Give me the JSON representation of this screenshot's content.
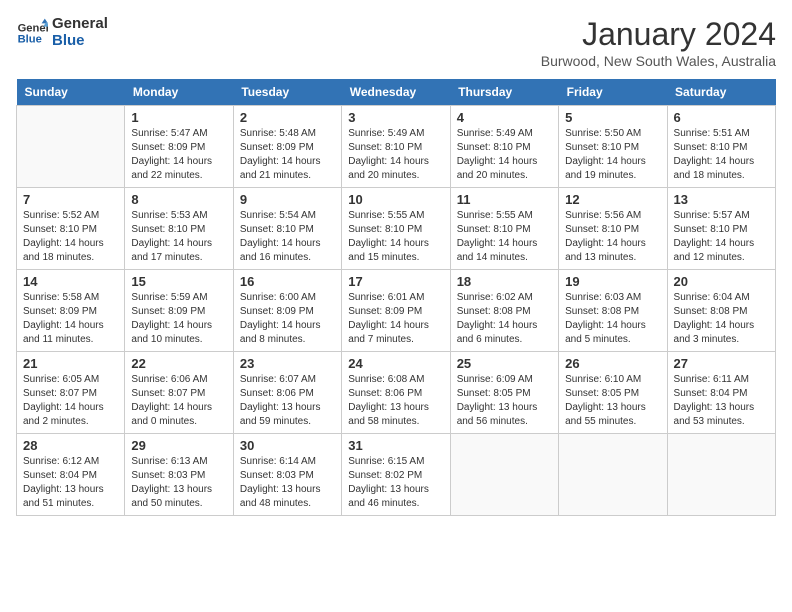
{
  "logo": {
    "line1": "General",
    "line2": "Blue"
  },
  "title": "January 2024",
  "subtitle": "Burwood, New South Wales, Australia",
  "days_of_week": [
    "Sunday",
    "Monday",
    "Tuesday",
    "Wednesday",
    "Thursday",
    "Friday",
    "Saturday"
  ],
  "weeks": [
    [
      {
        "day": "",
        "info": ""
      },
      {
        "day": "1",
        "info": "Sunrise: 5:47 AM\nSunset: 8:09 PM\nDaylight: 14 hours\nand 22 minutes."
      },
      {
        "day": "2",
        "info": "Sunrise: 5:48 AM\nSunset: 8:09 PM\nDaylight: 14 hours\nand 21 minutes."
      },
      {
        "day": "3",
        "info": "Sunrise: 5:49 AM\nSunset: 8:10 PM\nDaylight: 14 hours\nand 20 minutes."
      },
      {
        "day": "4",
        "info": "Sunrise: 5:49 AM\nSunset: 8:10 PM\nDaylight: 14 hours\nand 20 minutes."
      },
      {
        "day": "5",
        "info": "Sunrise: 5:50 AM\nSunset: 8:10 PM\nDaylight: 14 hours\nand 19 minutes."
      },
      {
        "day": "6",
        "info": "Sunrise: 5:51 AM\nSunset: 8:10 PM\nDaylight: 14 hours\nand 18 minutes."
      }
    ],
    [
      {
        "day": "7",
        "info": "Sunrise: 5:52 AM\nSunset: 8:10 PM\nDaylight: 14 hours\nand 18 minutes."
      },
      {
        "day": "8",
        "info": "Sunrise: 5:53 AM\nSunset: 8:10 PM\nDaylight: 14 hours\nand 17 minutes."
      },
      {
        "day": "9",
        "info": "Sunrise: 5:54 AM\nSunset: 8:10 PM\nDaylight: 14 hours\nand 16 minutes."
      },
      {
        "day": "10",
        "info": "Sunrise: 5:55 AM\nSunset: 8:10 PM\nDaylight: 14 hours\nand 15 minutes."
      },
      {
        "day": "11",
        "info": "Sunrise: 5:55 AM\nSunset: 8:10 PM\nDaylight: 14 hours\nand 14 minutes."
      },
      {
        "day": "12",
        "info": "Sunrise: 5:56 AM\nSunset: 8:10 PM\nDaylight: 14 hours\nand 13 minutes."
      },
      {
        "day": "13",
        "info": "Sunrise: 5:57 AM\nSunset: 8:10 PM\nDaylight: 14 hours\nand 12 minutes."
      }
    ],
    [
      {
        "day": "14",
        "info": "Sunrise: 5:58 AM\nSunset: 8:09 PM\nDaylight: 14 hours\nand 11 minutes."
      },
      {
        "day": "15",
        "info": "Sunrise: 5:59 AM\nSunset: 8:09 PM\nDaylight: 14 hours\nand 10 minutes."
      },
      {
        "day": "16",
        "info": "Sunrise: 6:00 AM\nSunset: 8:09 PM\nDaylight: 14 hours\nand 8 minutes."
      },
      {
        "day": "17",
        "info": "Sunrise: 6:01 AM\nSunset: 8:09 PM\nDaylight: 14 hours\nand 7 minutes."
      },
      {
        "day": "18",
        "info": "Sunrise: 6:02 AM\nSunset: 8:08 PM\nDaylight: 14 hours\nand 6 minutes."
      },
      {
        "day": "19",
        "info": "Sunrise: 6:03 AM\nSunset: 8:08 PM\nDaylight: 14 hours\nand 5 minutes."
      },
      {
        "day": "20",
        "info": "Sunrise: 6:04 AM\nSunset: 8:08 PM\nDaylight: 14 hours\nand 3 minutes."
      }
    ],
    [
      {
        "day": "21",
        "info": "Sunrise: 6:05 AM\nSunset: 8:07 PM\nDaylight: 14 hours\nand 2 minutes."
      },
      {
        "day": "22",
        "info": "Sunrise: 6:06 AM\nSunset: 8:07 PM\nDaylight: 14 hours\nand 0 minutes."
      },
      {
        "day": "23",
        "info": "Sunrise: 6:07 AM\nSunset: 8:06 PM\nDaylight: 13 hours\nand 59 minutes."
      },
      {
        "day": "24",
        "info": "Sunrise: 6:08 AM\nSunset: 8:06 PM\nDaylight: 13 hours\nand 58 minutes."
      },
      {
        "day": "25",
        "info": "Sunrise: 6:09 AM\nSunset: 8:05 PM\nDaylight: 13 hours\nand 56 minutes."
      },
      {
        "day": "26",
        "info": "Sunrise: 6:10 AM\nSunset: 8:05 PM\nDaylight: 13 hours\nand 55 minutes."
      },
      {
        "day": "27",
        "info": "Sunrise: 6:11 AM\nSunset: 8:04 PM\nDaylight: 13 hours\nand 53 minutes."
      }
    ],
    [
      {
        "day": "28",
        "info": "Sunrise: 6:12 AM\nSunset: 8:04 PM\nDaylight: 13 hours\nand 51 minutes."
      },
      {
        "day": "29",
        "info": "Sunrise: 6:13 AM\nSunset: 8:03 PM\nDaylight: 13 hours\nand 50 minutes."
      },
      {
        "day": "30",
        "info": "Sunrise: 6:14 AM\nSunset: 8:03 PM\nDaylight: 13 hours\nand 48 minutes."
      },
      {
        "day": "31",
        "info": "Sunrise: 6:15 AM\nSunset: 8:02 PM\nDaylight: 13 hours\nand 46 minutes."
      },
      {
        "day": "",
        "info": ""
      },
      {
        "day": "",
        "info": ""
      },
      {
        "day": "",
        "info": ""
      }
    ]
  ]
}
